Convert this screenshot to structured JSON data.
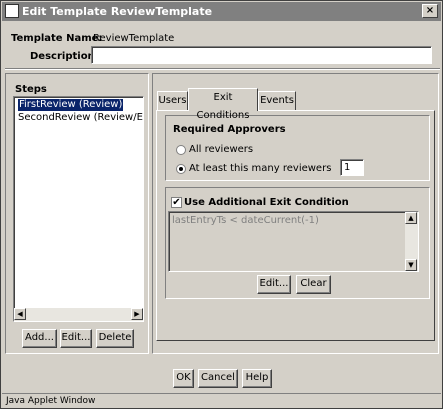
{
  "window": {
    "title": "Edit Template ReviewTemplate",
    "close_glyph": "×"
  },
  "form": {
    "template_name_label": "Template Name:",
    "template_name_value": "ReviewTemplate",
    "description_label": "Description:",
    "description_value": ""
  },
  "steps": {
    "heading": "Steps",
    "items": [
      {
        "label": "FirstReview (Review)",
        "selected": true
      },
      {
        "label": "SecondReview (Review/Edit Re",
        "selected": false
      }
    ],
    "add_label": "Add...",
    "edit_label": "Edit...",
    "delete_label": "Delete"
  },
  "tabs": [
    {
      "label": "Users",
      "active": false
    },
    {
      "label": "Exit Conditions",
      "active": true
    },
    {
      "label": "Events",
      "active": false
    }
  ],
  "exit_conditions": {
    "required_approvers_heading": "Required Approvers",
    "all_reviewers_label": "All reviewers",
    "all_reviewers_checked": false,
    "at_least_label": "At least this many reviewers",
    "at_least_checked": true,
    "reviewer_count": "1",
    "use_additional_label": "Use Additional Exit Condition",
    "use_additional_checked": true,
    "condition_text": "lastEntryTs < dateCurrent(-1)",
    "edit_label": "Edit...",
    "clear_label": "Clear"
  },
  "buttons": {
    "ok_label": "OK",
    "cancel_label": "Cancel",
    "help_label": "Help"
  },
  "status_bar": "Java Applet Window",
  "icons": {
    "scroll_left": "◀",
    "scroll_right": "▶",
    "scroll_up": "▲",
    "scroll_down": "▼",
    "checkmark": "✔"
  }
}
